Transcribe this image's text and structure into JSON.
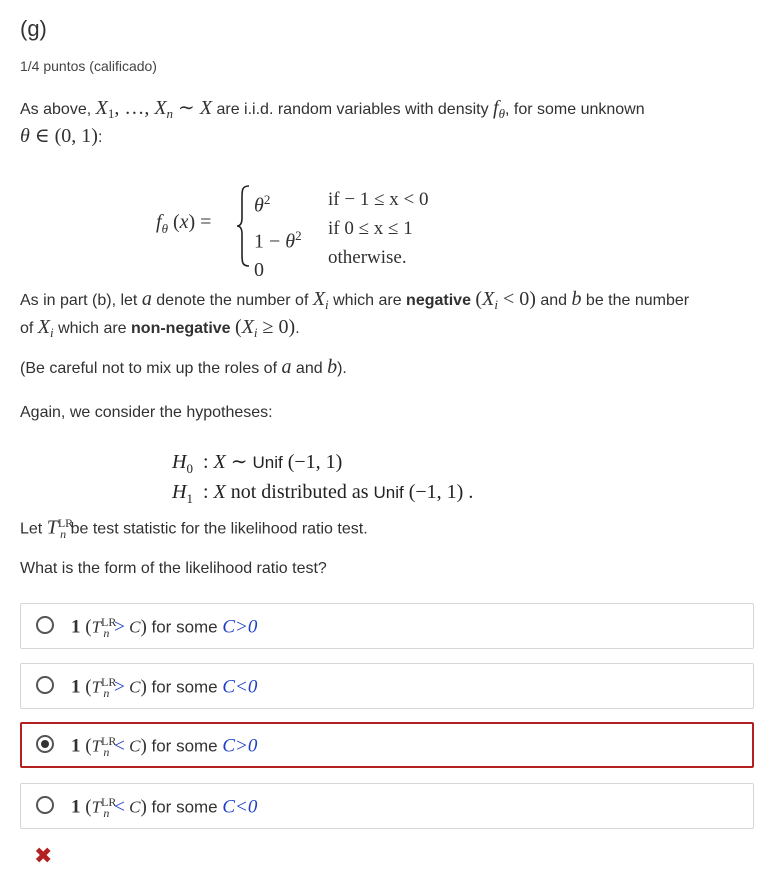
{
  "question": {
    "heading": "(g)",
    "points": "1/4 puntos (calificado)",
    "intro_prefix": "As above, ",
    "intro_mid": " are i.i.d. random variables with density ",
    "intro_suffix": ", for some unknown",
    "theta_domain_end": ":",
    "para_b_prefix": "As in part (b), let ",
    "para_b_mid1": " denote the number of ",
    "para_b_mid2": " which are ",
    "negative_word": "negative",
    "para_b_mid3": " and ",
    "para_b_mid4": " be the number",
    "para_b_line2_prefix": "of ",
    "para_b_line2_mid": " which are ",
    "nonnegative_word": "non-negative",
    "para_b_end": ".",
    "careful_text": "(Be careful not to mix up the roles of ",
    "careful_and": " and ",
    "careful_end": ").",
    "again_text": "Again, we consider the hypotheses:",
    "unif_word": "Unif",
    "not_distributed": "not distributed as",
    "let_prefix": "Let ",
    "let_suffix": " be test statistic for the likelihood ratio test.",
    "form_question": "What is the form of the likelihood ratio test?",
    "density": {
      "case1": "if − 1 ≤ x < 0",
      "case2": "if 0 ≤ x ≤ 1",
      "case3": "otherwise."
    }
  },
  "options": [
    {
      "op": ">",
      "c": "C>0",
      "selected": false
    },
    {
      "op": ">",
      "c": "C<0",
      "selected": false
    },
    {
      "op": "<",
      "c": "C>0",
      "selected": true
    },
    {
      "op": "<",
      "c": "C<0",
      "selected": false
    }
  ],
  "option_mid": " for some ",
  "result_icon": "wrong-x-icon",
  "colors": {
    "selected_border": "#b3201f",
    "wrong_icon": "#b3201f",
    "math_blue": "#1f3fc8"
  }
}
